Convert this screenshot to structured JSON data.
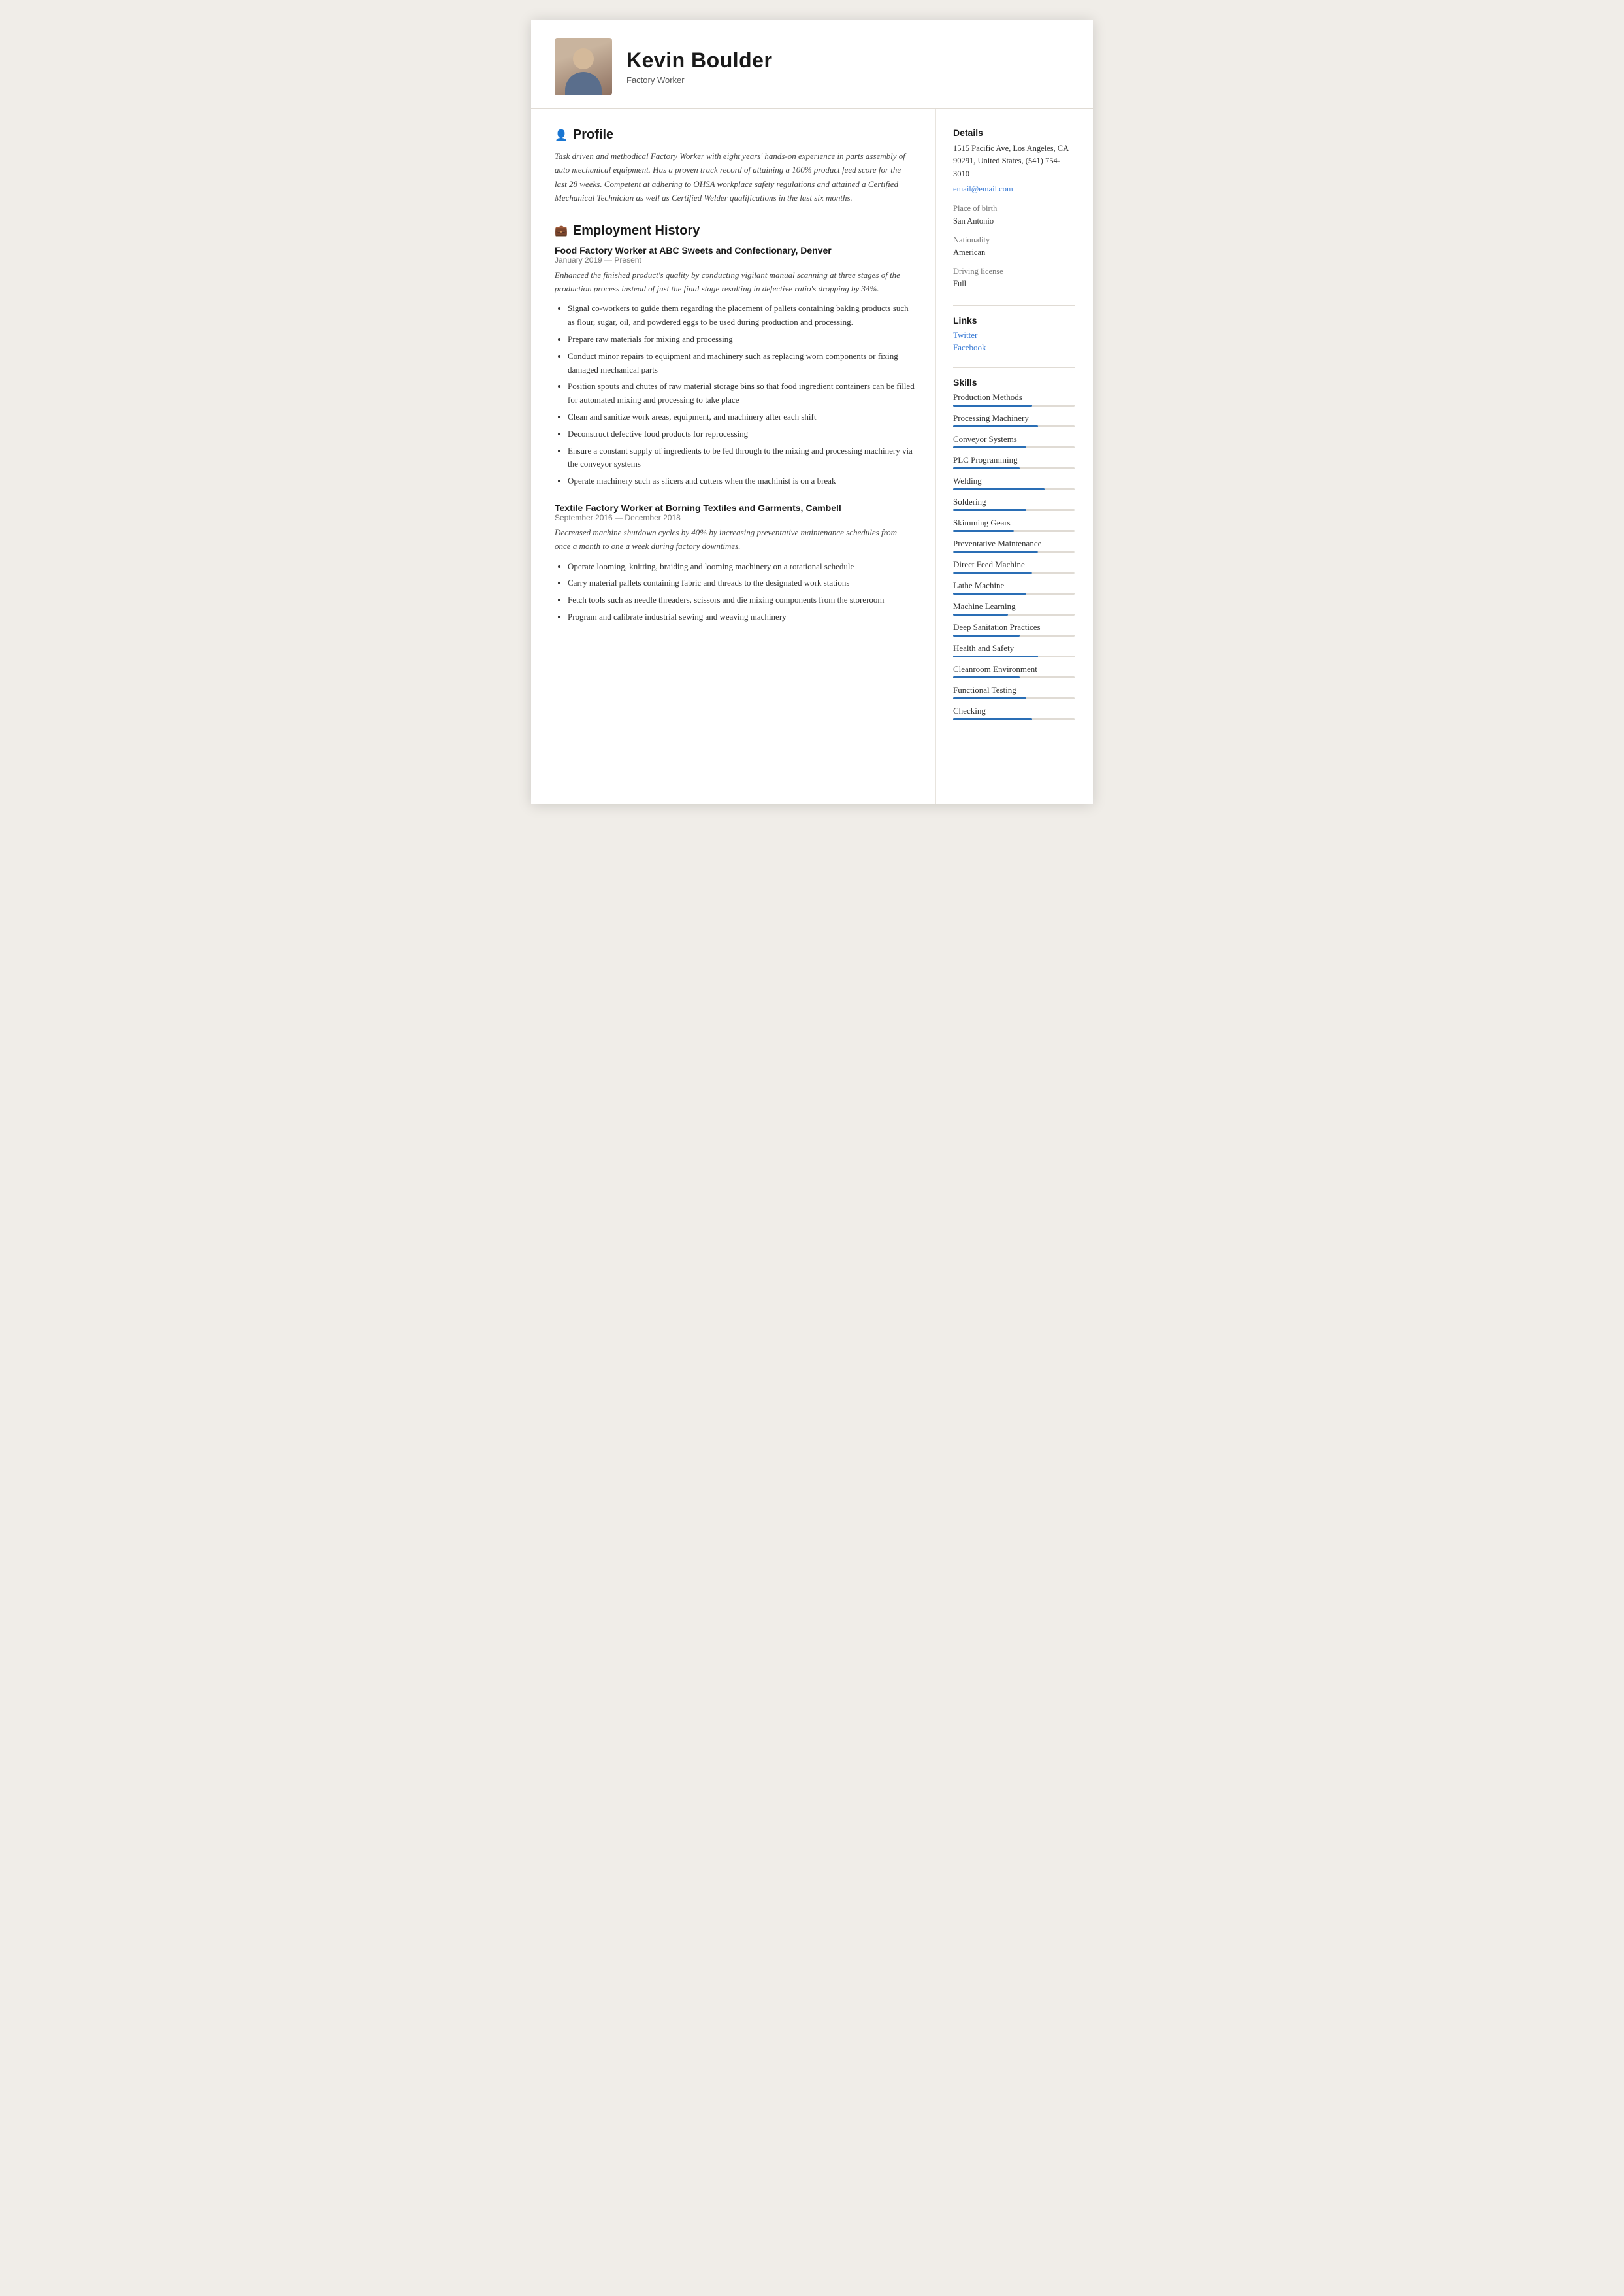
{
  "header": {
    "name": "Kevin Boulder",
    "title": "Factory Worker"
  },
  "profile": {
    "section_title": "Profile",
    "text": "Task driven and methodical Factory Worker with eight years' hands-on experience in parts assembly of auto mechanical equipment. Has a proven track record of attaining a 100% product feed score for the last 28 weeks. Competent at adhering to OHSA workplace safety regulations and attained a Certified Mechanical Technician as well as Certified Welder qualifications in the last six months."
  },
  "employment": {
    "section_title": "Employment History",
    "jobs": [
      {
        "title": "Food Factory Worker at  ABC Sweets and Confectionary, Denver",
        "date": "January 2019 — Present",
        "desc": "Enhanced the finished product's quality by conducting vigilant manual scanning at three stages of the production process instead of just the final stage resulting in defective ratio's dropping by 34%.",
        "bullets": [
          "Signal co-workers to guide them regarding the placement of pallets containing baking products such as flour, sugar, oil, and powdered eggs to be used during production and processing.",
          "Prepare raw materials for mixing and processing",
          "Conduct minor repairs to equipment and machinery such as replacing worn components or fixing damaged mechanical parts",
          "Position spouts and chutes of raw material storage bins so that food ingredient containers can be filled for automated mixing and processing to take place",
          "Clean and sanitize work areas, equipment, and machinery after each shift",
          "Deconstruct defective food products for reprocessing",
          "Ensure a constant supply of ingredients to be fed through to the mixing and processing machinery via the conveyor systems",
          "Operate machinery such as slicers and cutters when the machinist is on a break"
        ]
      },
      {
        "title": "Textile Factory Worker at  Borning Textiles and Garments, Cambell",
        "date": "September 2016 — December 2018",
        "desc": "Decreased machine shutdown cycles by 40% by increasing preventative maintenance schedules from once a month to one a week during factory downtimes.",
        "bullets": [
          "Operate looming, knitting, braiding and looming machinery on a rotational schedule",
          "Carry material pallets containing fabric and threads to the designated work stations",
          "Fetch tools such as needle threaders, scissors and die mixing components from the storeroom",
          "Program and calibrate industrial sewing and weaving machinery"
        ]
      }
    ]
  },
  "details": {
    "section_title": "Details",
    "address": "1515 Pacific Ave, Los Angeles, CA 90291, United States, (541) 754-3010",
    "email": "email@email.com",
    "place_of_birth_label": "Place of birth",
    "place_of_birth": "San Antonio",
    "nationality_label": "Nationality",
    "nationality": "American",
    "driving_license_label": "Driving license",
    "driving_license": "Full"
  },
  "links": {
    "section_title": "Links",
    "items": [
      {
        "label": "Twitter",
        "href": "#"
      },
      {
        "label": "Facebook",
        "href": "#"
      }
    ]
  },
  "skills": {
    "section_title": "Skills",
    "items": [
      {
        "name": "Production Methods",
        "fill": "65%"
      },
      {
        "name": "Processing Machinery",
        "fill": "70%"
      },
      {
        "name": "Conveyor Systems",
        "fill": "60%"
      },
      {
        "name": "PLC Programming",
        "fill": "55%"
      },
      {
        "name": "Welding",
        "fill": "75%"
      },
      {
        "name": "Soldering",
        "fill": "60%"
      },
      {
        "name": "Skimming Gears",
        "fill": "50%"
      },
      {
        "name": "Preventative Maintenance",
        "fill": "70%"
      },
      {
        "name": "Direct Feed Machine",
        "fill": "65%"
      },
      {
        "name": "Lathe Machine",
        "fill": "60%"
      },
      {
        "name": "Machine Learning",
        "fill": "45%"
      },
      {
        "name": "Deep Sanitation Practices",
        "fill": "55%"
      },
      {
        "name": "Health and Safety",
        "fill": "70%"
      },
      {
        "name": "Cleanroom Environment",
        "fill": "55%"
      },
      {
        "name": "Functional Testing",
        "fill": "60%"
      },
      {
        "name": "Checking",
        "fill": "65%"
      }
    ]
  }
}
